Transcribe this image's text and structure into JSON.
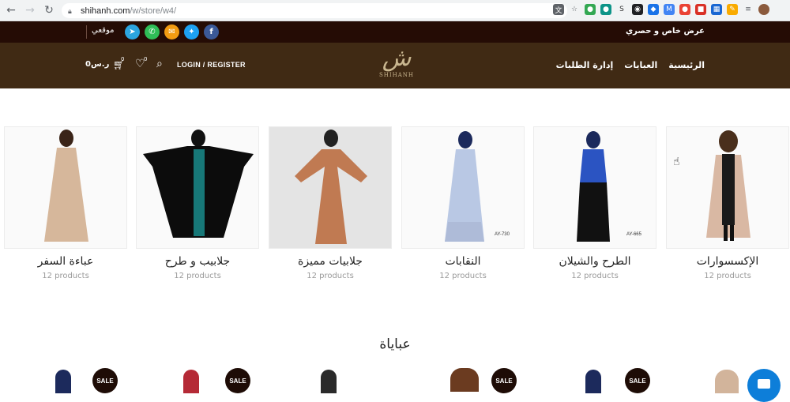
{
  "browser": {
    "url_host": "shihanh.com",
    "url_path": "/w/store/w4/"
  },
  "topbar": {
    "promo": "عرض خاص و حصري",
    "my_site": "موقعي",
    "socials": [
      {
        "name": "telegram",
        "color": "#2ca5e0",
        "glyph": "➤"
      },
      {
        "name": "whatsapp",
        "color": "#2fbe57",
        "glyph": "✆"
      },
      {
        "name": "email",
        "color": "#f39c12",
        "glyph": "✉"
      },
      {
        "name": "twitter",
        "color": "#1da1f2",
        "glyph": "✦"
      },
      {
        "name": "facebook",
        "color": "#3b5998",
        "glyph": "f"
      }
    ]
  },
  "header": {
    "menu": [
      "الرئيسية",
      "العبايات",
      "إدارة الطلبات"
    ],
    "logo_word": "SHIHANH",
    "login": "LOGIN / REGISTER",
    "wishlist_count": "0",
    "cart_count": "0",
    "currency": "0ر.س"
  },
  "categories": [
    {
      "name": "الإكسسوارات",
      "count": "12 products",
      "tag": ""
    },
    {
      "name": "الطرح والشيلان",
      "count": "12 products",
      "tag": "AY-665"
    },
    {
      "name": "النقابات",
      "count": "12 products",
      "tag": "AY-730"
    },
    {
      "name": "جلابيات مميزة",
      "count": "12 products",
      "tag": ""
    },
    {
      "name": "جلابيب و طرح",
      "count": "12 products",
      "tag": ""
    },
    {
      "name": "عباءة السفر",
      "count": "12 products",
      "tag": ""
    }
  ],
  "section": {
    "title": "عباياة"
  },
  "products_row": {
    "sale_label": "SALE"
  },
  "colors": {
    "topbar_bg": "#250c05",
    "header_bg": "#402a14",
    "brand_gold": "#c9b68f"
  }
}
